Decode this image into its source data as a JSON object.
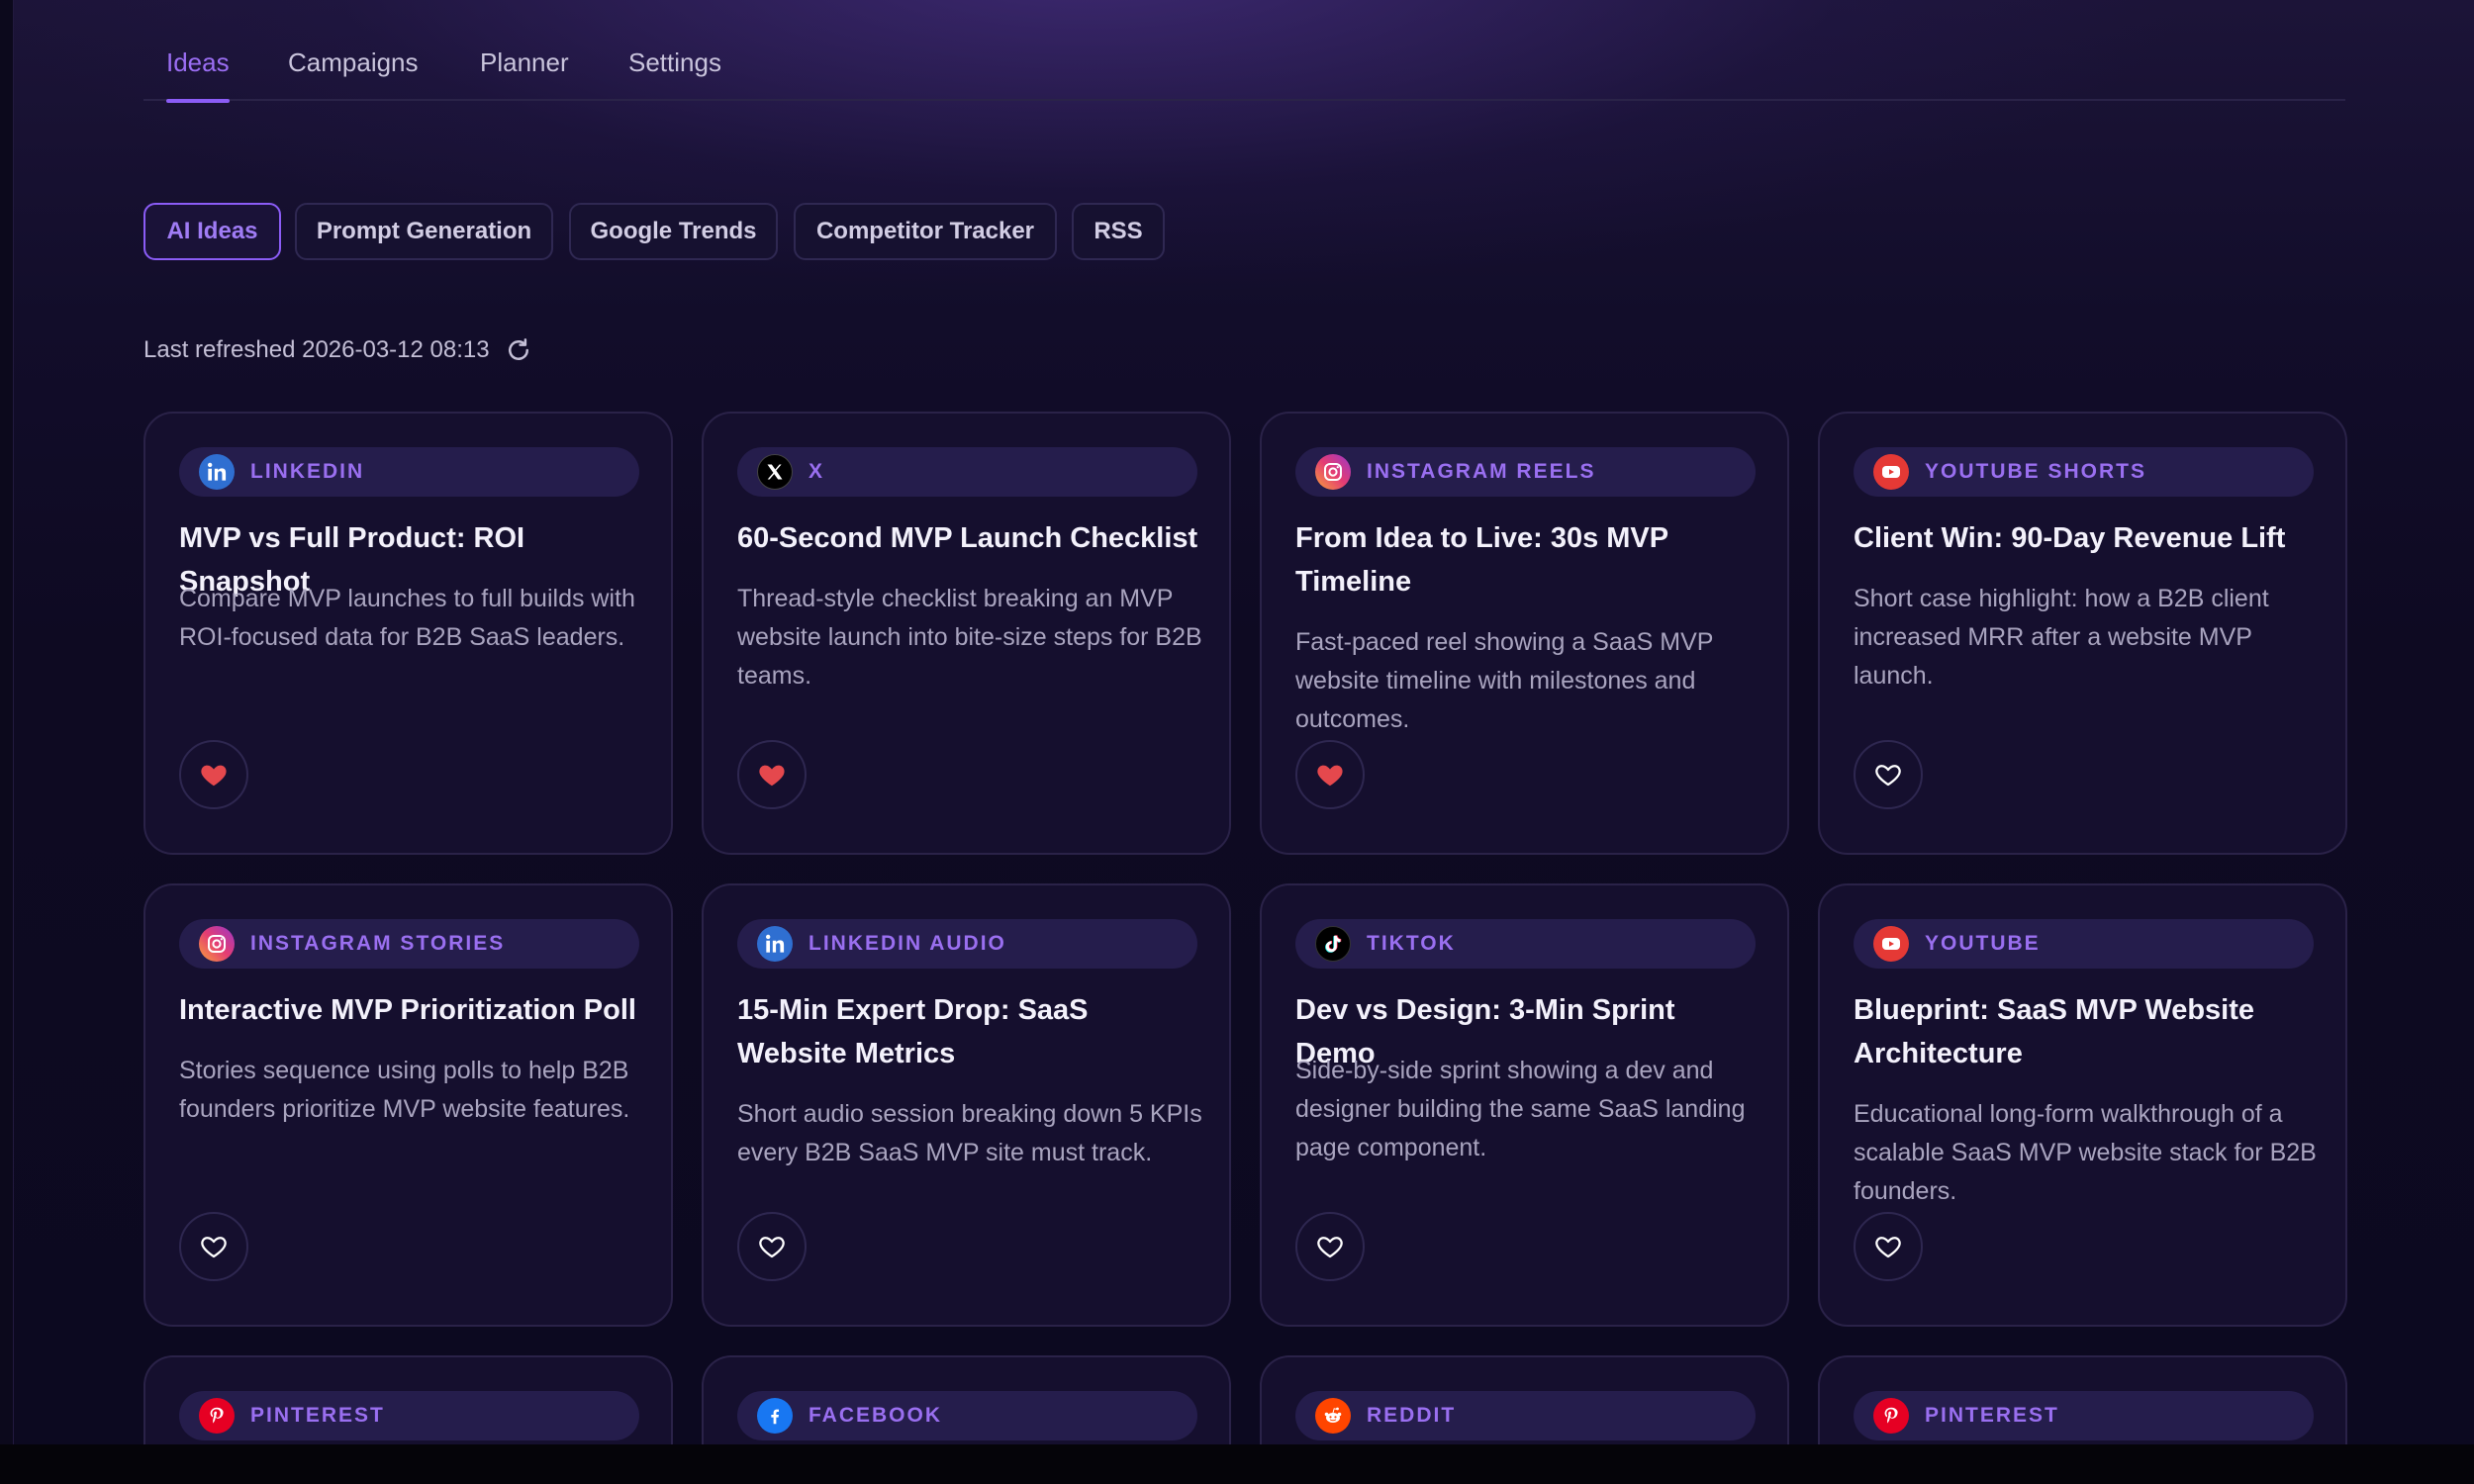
{
  "tabs": [
    {
      "label": "Ideas",
      "active": true
    },
    {
      "label": "Campaigns",
      "active": false
    },
    {
      "label": "Planner",
      "active": false
    },
    {
      "label": "Settings",
      "active": false
    }
  ],
  "filters": [
    {
      "label": "AI Ideas",
      "active": true
    },
    {
      "label": "Prompt Generation",
      "active": false
    },
    {
      "label": "Google Trends",
      "active": false
    },
    {
      "label": "Competitor Tracker",
      "active": false
    },
    {
      "label": "RSS",
      "active": false
    }
  ],
  "refresh": {
    "text": "Last refreshed 2026-03-12 08:13",
    "icon": "refresh-icon"
  },
  "colors": {
    "accent": "#8b5cf6",
    "liked": "#e5484d",
    "background": "#0d0a1f",
    "card": "#150f2e"
  },
  "cards": [
    {
      "platform": "LINKEDIN",
      "icon": "linkedin-icon",
      "title": "MVP vs Full Product: ROI Snapshot",
      "description": "Compare MVP launches to full builds with ROI-focused data for B2B SaaS leaders.",
      "liked": true
    },
    {
      "platform": "X",
      "icon": "x-icon",
      "title": "60-Second MVP Launch Checklist",
      "description": "Thread-style checklist breaking an MVP website launch into bite-size steps for B2B teams.",
      "liked": true
    },
    {
      "platform": "INSTAGRAM REELS",
      "icon": "instagram-icon",
      "title": "From Idea to Live: 30s MVP Timeline",
      "description": "Fast-paced reel showing a SaaS MVP website timeline with milestones and outcomes.",
      "liked": true
    },
    {
      "platform": "YOUTUBE SHORTS",
      "icon": "youtube-icon",
      "title": "Client Win: 90-Day Revenue Lift",
      "description": "Short case highlight: how a B2B client increased MRR after a website MVP launch.",
      "liked": false
    },
    {
      "platform": "INSTAGRAM STORIES",
      "icon": "instagram-icon",
      "title": "Interactive MVP Prioritization Poll",
      "description": "Stories sequence using polls to help B2B founders prioritize MVP website features.",
      "liked": false
    },
    {
      "platform": "LINKEDIN AUDIO",
      "icon": "linkedin-icon",
      "title": "15-Min Expert Drop: SaaS Website Metrics",
      "description": "Short audio session breaking down 5 KPIs every B2B SaaS MVP site must track.",
      "liked": false
    },
    {
      "platform": "TIKTOK",
      "icon": "tiktok-icon",
      "title": "Dev vs Design: 3-Min Sprint Demo",
      "description": "Side-by-side sprint showing a dev and designer building the same SaaS landing page component.",
      "liked": false
    },
    {
      "platform": "YOUTUBE",
      "icon": "youtube-icon",
      "title": "Blueprint: SaaS MVP Website Architecture",
      "description": "Educational long-form walkthrough of a scalable SaaS MVP website stack for B2B founders.",
      "liked": false
    },
    {
      "platform": "PINTEREST",
      "icon": "pinterest-icon"
    },
    {
      "platform": "FACEBOOK",
      "icon": "facebook-icon"
    },
    {
      "platform": "REDDIT",
      "icon": "reddit-icon"
    },
    {
      "platform": "PINTEREST",
      "icon": "pinterest-icon"
    }
  ]
}
